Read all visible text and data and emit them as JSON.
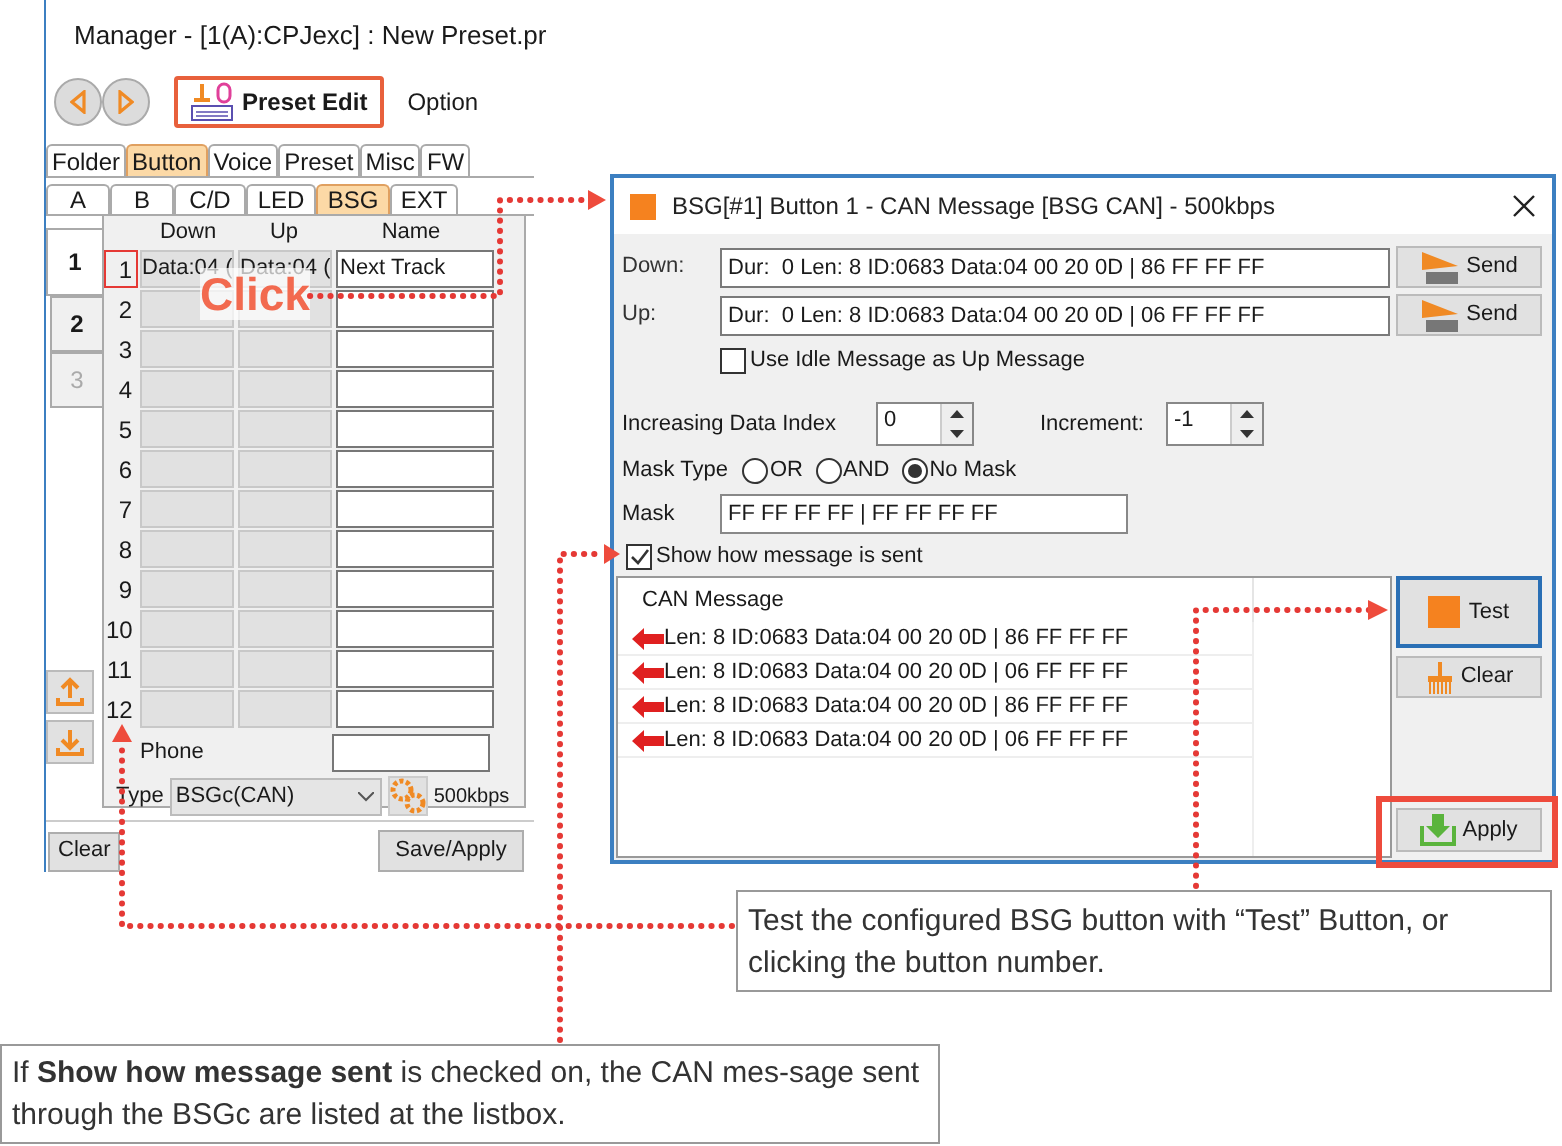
{
  "manager": {
    "title": "Manager - [1(A):CPJexc] : New Preset.pr",
    "preset_edit": "Preset Edit",
    "option": "Option",
    "tabs": [
      {
        "label": "Folder",
        "selected": false
      },
      {
        "label": "Button",
        "selected": true
      },
      {
        "label": "Voice",
        "selected": false
      },
      {
        "label": "Preset",
        "selected": false
      },
      {
        "label": "Misc",
        "selected": false
      },
      {
        "label": "FW",
        "selected": false
      }
    ],
    "subtabs": [
      {
        "label": "A",
        "selected": false
      },
      {
        "label": "B",
        "selected": false
      },
      {
        "label": "C/D",
        "selected": false
      },
      {
        "label": "LED",
        "selected": false
      },
      {
        "label": "BSG",
        "selected": true
      },
      {
        "label": "EXT",
        "selected": false
      }
    ],
    "pages": [
      {
        "label": "1",
        "selected": true,
        "disabled": false
      },
      {
        "label": "2",
        "selected": false,
        "disabled": false
      },
      {
        "label": "3",
        "selected": false,
        "disabled": true
      }
    ],
    "columns": [
      "Down",
      "Up",
      "Name"
    ],
    "rows": [
      {
        "number": "1",
        "down": "Data:04 (",
        "up": "Data:04 (",
        "name": "Next Track",
        "selected": true
      },
      {
        "number": "2",
        "selected": false
      },
      {
        "number": "3",
        "selected": false
      },
      {
        "number": "4",
        "selected": false
      },
      {
        "number": "5",
        "selected": false
      },
      {
        "number": "6",
        "selected": false
      },
      {
        "number": "7",
        "selected": false
      },
      {
        "number": "8",
        "selected": false
      },
      {
        "number": "9",
        "selected": false
      },
      {
        "number": "10",
        "selected": false
      },
      {
        "number": "11",
        "selected": false
      },
      {
        "number": "12",
        "selected": false
      }
    ],
    "phone_label": "Phone",
    "type_label": "Type",
    "type_value": "BSGc(CAN)",
    "rate": "500kbps",
    "clear": "Clear",
    "save": "Save/Apply"
  },
  "dialog": {
    "title": "BSG[#1] Button 1 - CAN Message [BSG CAN] - 500kbps",
    "messages": [
      {
        "label": "Down:",
        "value": "Dur:  0 Len: 8 ID:0683 Data:04 00 20 0D | 86 FF FF FF",
        "button": "Send"
      },
      {
        "label": "Up:",
        "value": "Dur:  0 Len: 8 ID:0683 Data:04 00 20 0D | 06 FF FF FF",
        "button": "Send"
      }
    ],
    "idle": {
      "label": "Use Idle Message as Up Message",
      "checked": false
    },
    "index": {
      "label": "Increasing Data Index",
      "value": "0"
    },
    "increment": {
      "label": "Increment:",
      "value": "-1"
    },
    "mask_type": {
      "label": "Mask Type",
      "options": [
        {
          "label": "OR",
          "selected": false
        },
        {
          "label": "AND",
          "selected": false
        },
        {
          "label": "No Mask",
          "selected": true
        }
      ]
    },
    "mask": {
      "label": "Mask",
      "value": "FF FF FF FF | FF FF FF FF"
    },
    "show": {
      "label": "Show how message is sent",
      "checked": true
    },
    "list": {
      "header": "CAN Message",
      "items": [
        "Len: 8 ID:0683 Data:04 00 20 0D | 86 FF FF FF",
        "Len: 8 ID:0683 Data:04 00 20 0D | 06 FF FF FF",
        "Len: 8 ID:0683 Data:04 00 20 0D | 86 FF FF FF",
        "Len: 8 ID:0683 Data:04 00 20 0D | 06 FF FF FF"
      ]
    },
    "test": "Test",
    "clear": "Clear",
    "apply": "Apply"
  },
  "annotations": {
    "click": "Click",
    "callouts": [
      "Test the configured BSG button with “Test” Button, or clicking the button number.",
      "If **Show how message sent** is checked on, the CAN mes-sage sent through the BSGc are listed at the listbox."
    ]
  }
}
